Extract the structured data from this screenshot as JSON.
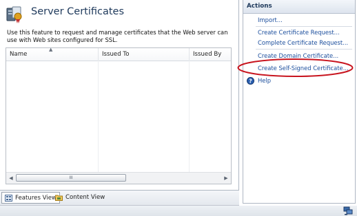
{
  "feature": {
    "title": "Server Certificates",
    "description": "Use this feature to request and manage certificates that the Web server can use with Web sites configured for SSL."
  },
  "grid": {
    "columns": [
      "Name",
      "Issued To",
      "Issued By"
    ],
    "rows": [],
    "scroll_glyph": "III"
  },
  "views": {
    "features_view": "Features View",
    "content_view": "Content View"
  },
  "actions": {
    "header": "Actions",
    "items": [
      "Import...",
      "Create Certificate Request...",
      "Complete Certificate Request...",
      "Create Domain Certificate...",
      "Create Self-Signed Certificate...",
      "Help"
    ]
  },
  "colors": {
    "link": "#1a4d9c",
    "title": "#1e395b",
    "highlight_ellipse": "#c8141e"
  },
  "icons": [
    "server-certificate-icon",
    "features-view-icon",
    "content-view-icon",
    "help-icon",
    "network-status-icon"
  ]
}
